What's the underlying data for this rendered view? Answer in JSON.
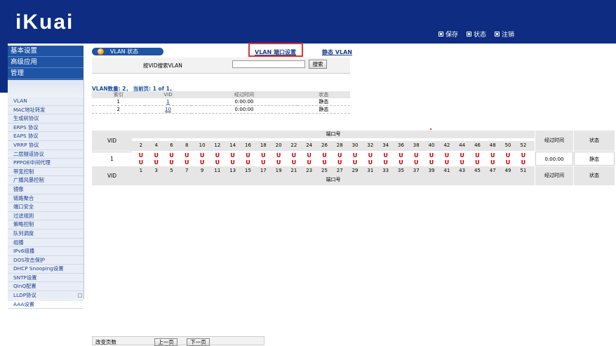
{
  "header": {
    "logo_text": "iKuai",
    "nav": [
      {
        "label": "保存",
        "icon": "save-icon"
      },
      {
        "label": "状态",
        "icon": "status-icon"
      },
      {
        "label": "注销",
        "icon": "logout-icon"
      }
    ]
  },
  "sidebar": {
    "top_menu": [
      "基本设置",
      "高级应用",
      "管理"
    ],
    "items": [
      "VLAN",
      "MAC地址转发",
      "生成树协议",
      "ERPS 协议",
      "EAPS 协议",
      "VRRP 协议",
      "二层隧道协议",
      "PPPOE中间代理",
      "带宽控制",
      "广播风暴控制",
      "镜像",
      "链路聚合",
      "端口安全",
      "过滤规则",
      "策略控制",
      "队列调度",
      "组播",
      "IPv6组播",
      "DOS攻击保护",
      "DHCP Snooping设置",
      "SNTP设置",
      "QinQ配置",
      "LLDP协议",
      "AAA设置"
    ]
  },
  "panel": {
    "title": "VLAN 状态",
    "link_port_settings": "VLAN 端口设置",
    "link_static_vlan": "静态 VLAN",
    "search_label": "按VID搜索VLAN",
    "search_value": "",
    "search_button": "搜索"
  },
  "summary": "VLAN数量: 2，  当前页: 1 of 1，",
  "vlan_list": {
    "headers": [
      "索引",
      "VID",
      "经过时间",
      "状态"
    ],
    "rows": [
      {
        "index": "1",
        "vid": "1",
        "time": "0:00:00",
        "state": "静态"
      },
      {
        "index": "2",
        "vid": "10",
        "time": "0:00:00",
        "state": "静态"
      }
    ]
  },
  "port_table": {
    "vid_header": "VID",
    "ports_header": "端口号",
    "time_header": "经过时间",
    "state_header": "状态",
    "even_ports": [
      "2",
      "4",
      "6",
      "8",
      "10",
      "12",
      "14",
      "16",
      "18",
      "20",
      "22",
      "24",
      "26",
      "28",
      "30",
      "32",
      "34",
      "36",
      "38",
      "40",
      "42",
      "44",
      "46",
      "48",
      "50",
      "52"
    ],
    "odd_ports": [
      "1",
      "3",
      "5",
      "7",
      "9",
      "11",
      "13",
      "15",
      "17",
      "19",
      "21",
      "23",
      "25",
      "27",
      "29",
      "31",
      "33",
      "35",
      "37",
      "39",
      "41",
      "43",
      "45",
      "47",
      "49",
      "51"
    ],
    "row": {
      "vid": "1",
      "even_marks": [
        "U",
        "U",
        "U",
        "U",
        "U",
        "U",
        "U",
        "U",
        "U",
        "U",
        "U",
        "U",
        "U",
        "U",
        "U",
        "U",
        "U",
        "U",
        "U",
        "U",
        "U",
        "U",
        "U",
        "U",
        "U",
        "U"
      ],
      "odd_marks": [
        "U",
        "U",
        "U",
        "U",
        "U",
        "U",
        "U",
        "U",
        "U",
        "U",
        "U",
        "U",
        "U",
        "U",
        "U",
        "U",
        "U",
        "U",
        "U",
        "U",
        "U",
        "U",
        "U",
        "U",
        "U",
        "U"
      ],
      "time": "0:00:00",
      "state": "静态"
    }
  },
  "pager": {
    "label": "改变页数",
    "prev": "上一页",
    "next": "下一页"
  }
}
